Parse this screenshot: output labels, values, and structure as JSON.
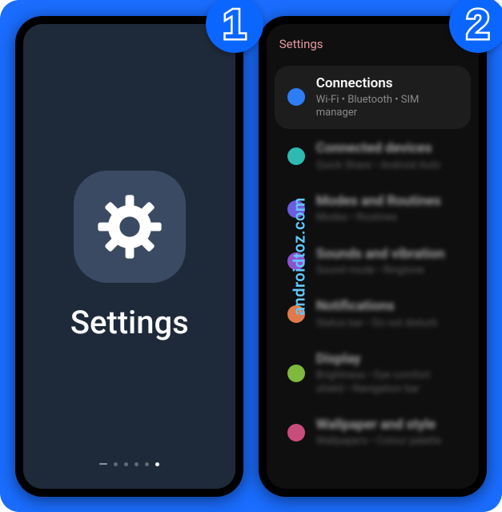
{
  "steps": {
    "one": "1",
    "two": "2"
  },
  "watermark": "androidtoz.com",
  "phone1": {
    "app_label": "Settings"
  },
  "phone2": {
    "header": "Settings",
    "items": [
      {
        "title": "Connections",
        "subtitle": "Wi-Fi  •  Bluetooth  •  SIM manager",
        "icon_color": "#2d7df6",
        "focus": true
      },
      {
        "title": "Connected devices",
        "subtitle": "Quick Share  •  Android Auto",
        "icon_color": "#2fb9b1",
        "focus": false
      },
      {
        "title": "Modes and Routines",
        "subtitle": "Modes  •  Routines",
        "icon_color": "#6b5ce0",
        "focus": false
      },
      {
        "title": "Sounds and vibration",
        "subtitle": "Sound mode  •  Ringtone",
        "icon_color": "#8c53d1",
        "focus": false
      },
      {
        "title": "Notifications",
        "subtitle": "Status bar  •  Do not disturb",
        "icon_color": "#e07a4a",
        "focus": false
      },
      {
        "title": "Display",
        "subtitle": "Brightness  •  Eye comfort shield  •  Navigation bar",
        "icon_color": "#7fb93d",
        "focus": false
      },
      {
        "title": "Wallpaper and style",
        "subtitle": "Wallpapers  •  Colour palette",
        "icon_color": "#c94d7a",
        "focus": false
      }
    ]
  }
}
